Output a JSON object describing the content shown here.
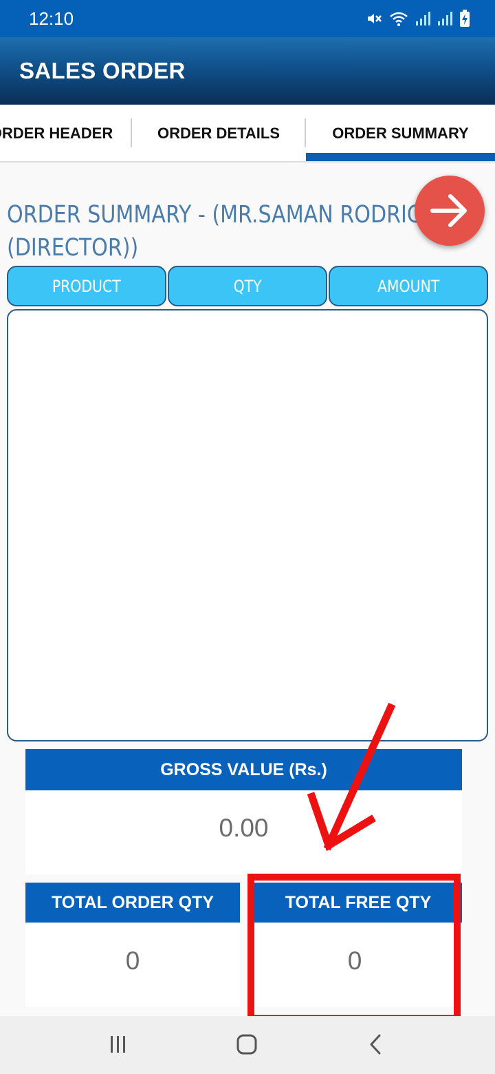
{
  "status_bar": {
    "time": "12:10"
  },
  "app_bar": {
    "title": "SALES ORDER"
  },
  "tabs": [
    {
      "label": "ORDER HEADER"
    },
    {
      "label": "ORDER DETAILS"
    },
    {
      "label": "ORDER SUMMARY",
      "selected": true
    }
  ],
  "summary": {
    "title_line1": "ORDER SUMMARY - (MR.SAMAN RODRIGO",
    "title_line2": "(DIRECTOR))",
    "columns": [
      "PRODUCT",
      "QTY",
      "AMOUNT"
    ],
    "rows": []
  },
  "totals": {
    "gross_label": "GROSS VALUE (Rs.)",
    "gross_value": "0.00",
    "order_qty_label": "TOTAL ORDER QTY",
    "order_qty_value": "0",
    "free_qty_label": "TOTAL FREE QTY",
    "free_qty_value": "0"
  },
  "icons": {
    "fab": "arrow-right-icon",
    "nav": [
      "recents-icon",
      "home-icon",
      "back-icon"
    ]
  },
  "colors": {
    "status_bar": "#0560b8",
    "tab_indicator": "#0a5fb4",
    "column_header": "#3cc4f6",
    "total_header": "#0862bb",
    "fab": "#e5524a",
    "annotation": "#ee1111"
  }
}
